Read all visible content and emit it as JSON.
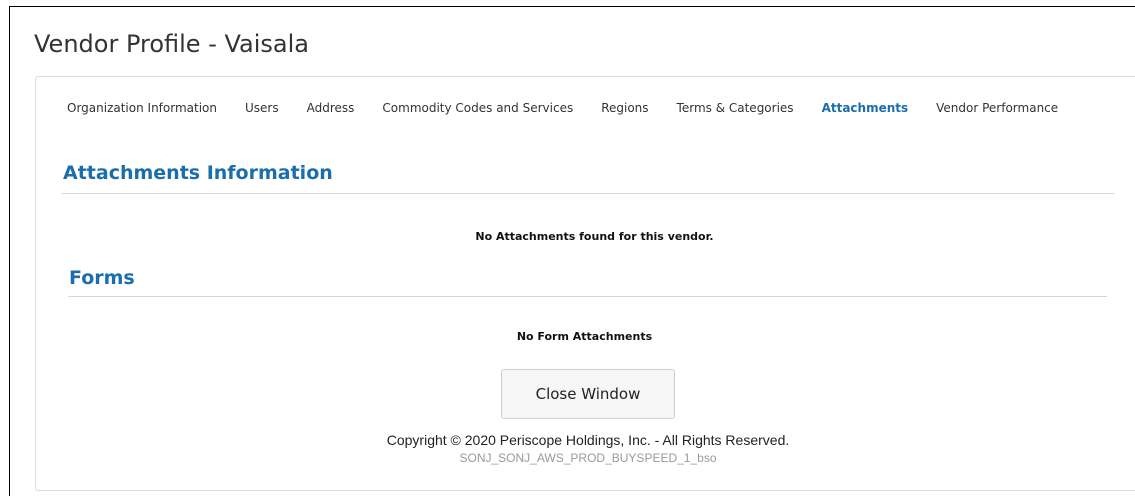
{
  "page": {
    "title": "Vendor Profile - Vaisala"
  },
  "tabs": [
    {
      "label": "Organization Information"
    },
    {
      "label": "Users"
    },
    {
      "label": "Address"
    },
    {
      "label": "Commodity Codes and Services"
    },
    {
      "label": "Regions"
    },
    {
      "label": "Terms & Categories"
    },
    {
      "label": "Attachments",
      "active": true
    },
    {
      "label": "Vendor Performance"
    }
  ],
  "attachments": {
    "heading": "Attachments Information",
    "empty_message": "No Attachments found for this vendor."
  },
  "forms": {
    "heading": "Forms",
    "empty_message": "No Form Attachments"
  },
  "actions": {
    "close_label": "Close Window"
  },
  "footer": {
    "copyright": "Copyright © 2020 Periscope Holdings, Inc. - All Rights Reserved.",
    "server": "SONJ_SONJ_AWS_PROD_BUYSPEED_1_bso"
  },
  "colors": {
    "accent": "#1a6eab",
    "text": "#222222",
    "muted": "#9a9a9a"
  }
}
